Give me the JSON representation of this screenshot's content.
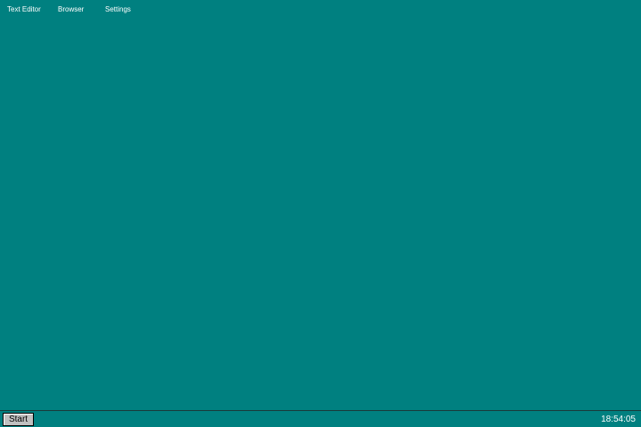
{
  "desktop": {
    "background_color": "#008080",
    "icons": [
      {
        "label": "Text Editor",
        "icon": "text-editor-icon"
      },
      {
        "label": "Browser",
        "icon": "browser-icon"
      },
      {
        "label": "Settings",
        "icon": "settings-icon"
      }
    ]
  },
  "taskbar": {
    "start_label": "Start",
    "clock": "18:54:05"
  }
}
